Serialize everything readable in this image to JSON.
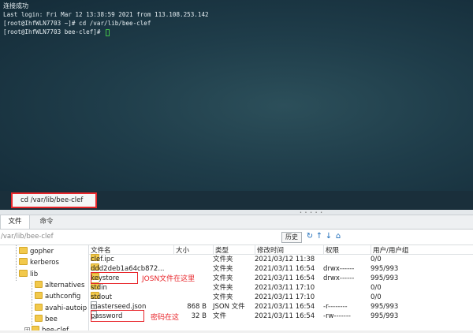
{
  "terminal": {
    "lines": [
      "连接成功",
      "Last login: Fri Mar 12 13:38:59 2021 from 113.108.253.142",
      "[root@IhfWLN7703 ~]# cd /var/lib/bee-clef",
      "[root@IhfWLN7703 bee-clef]# "
    ],
    "command_input": "cd /var/lib/bee-clef"
  },
  "tabs": [
    {
      "label": "文件",
      "active": true
    },
    {
      "label": "命令",
      "active": false
    }
  ],
  "pathbar": {
    "path": "/var/lib/bee-clef",
    "history_label": "历史"
  },
  "tree": [
    {
      "label": "gopher",
      "depth": 1
    },
    {
      "label": "kerberos",
      "depth": 1
    },
    {
      "label": "lib",
      "depth": 1,
      "expanded": true
    },
    {
      "label": "alternatives",
      "depth": 2
    },
    {
      "label": "authconfig",
      "depth": 2
    },
    {
      "label": "avahi-autoip",
      "depth": 2
    },
    {
      "label": "bee",
      "depth": 2
    },
    {
      "label": "bee-clef",
      "depth": 2,
      "expander": "+"
    }
  ],
  "files": {
    "columns": [
      "文件名",
      "大小",
      "类型",
      "修改时间",
      "权限",
      "用户/用户组"
    ],
    "rows": [
      {
        "name": "clef.ipc",
        "size": "",
        "type": "文件夹",
        "modified": "2021/03/12 11:38",
        "perm": "",
        "owner": "0/0",
        "icon": "folder"
      },
      {
        "name": "ddd2deb1a64cb872...",
        "size": "",
        "type": "文件夹",
        "modified": "2021/03/11 16:54",
        "perm": "drwx------",
        "owner": "995/993",
        "icon": "folder"
      },
      {
        "name": "keystore",
        "size": "",
        "type": "文件夹",
        "modified": "2021/03/11 16:54",
        "perm": "drwx------",
        "owner": "995/993",
        "icon": "folder"
      },
      {
        "name": "stdin",
        "size": "",
        "type": "文件夹",
        "modified": "2021/03/11 17:10",
        "perm": "",
        "owner": "0/0",
        "icon": "folder"
      },
      {
        "name": "stdout",
        "size": "",
        "type": "文件夹",
        "modified": "2021/03/11 17:10",
        "perm": "",
        "owner": "0/0",
        "icon": "folder"
      },
      {
        "name": "masterseed.json",
        "size": "868 B",
        "type": "JSON 文件",
        "modified": "2021/03/11 16:54",
        "perm": "-r--------",
        "owner": "995/993",
        "icon": "file"
      },
      {
        "name": "password",
        "size": "32 B",
        "type": "文件",
        "modified": "2021/03/11 16:54",
        "perm": "-rw-------",
        "owner": "995/993",
        "icon": "file"
      }
    ]
  },
  "annotations": {
    "keystore_note": "JOSN文件在这里",
    "password_note": "密码在这"
  },
  "colors": {
    "annotation": "#e8262b",
    "terminal_bg": "#1f3d4a",
    "cursor": "#43c04a",
    "folder": "#f2c94c"
  },
  "icons": [
    "refresh-icon",
    "upload-icon",
    "download-icon",
    "home-icon"
  ]
}
